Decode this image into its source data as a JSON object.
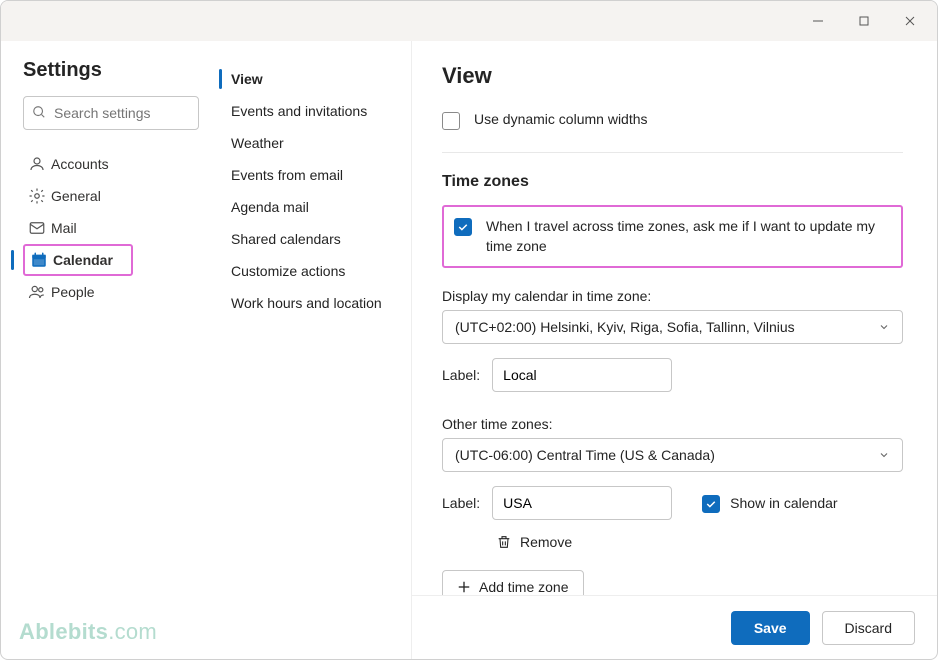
{
  "settings_title": "Settings",
  "search": {
    "placeholder": "Search settings"
  },
  "sidebar": {
    "items": [
      {
        "label": "Accounts"
      },
      {
        "label": "General"
      },
      {
        "label": "Mail"
      },
      {
        "label": "Calendar"
      },
      {
        "label": "People"
      }
    ]
  },
  "subnav": {
    "items": [
      {
        "label": "View"
      },
      {
        "label": "Events and invitations"
      },
      {
        "label": "Weather"
      },
      {
        "label": "Events from email"
      },
      {
        "label": "Agenda mail"
      },
      {
        "label": "Shared calendars"
      },
      {
        "label": "Customize actions"
      },
      {
        "label": "Work hours and location"
      }
    ]
  },
  "main": {
    "title": "View",
    "dynamic_widths_label": "Use dynamic column widths",
    "timezones": {
      "heading": "Time zones",
      "travel_label": "When I travel across time zones, ask me if I want to update my time zone",
      "display_label": "Display my calendar in time zone:",
      "primary_tz_value": "(UTC+02:00) Helsinki, Kyiv, Riga, Sofia, Tallinn, Vilnius",
      "label_text": "Label:",
      "primary_label_value": "Local",
      "other_heading": "Other time zones:",
      "other_tz_value": "(UTC-06:00) Central Time (US & Canada)",
      "other_label_value": "USA",
      "show_in_cal": "Show in calendar",
      "remove": "Remove",
      "add": "Add time zone"
    }
  },
  "footer": {
    "save": "Save",
    "discard": "Discard"
  },
  "watermark": {
    "brand": "Ablebits",
    "suffix": ".com"
  }
}
